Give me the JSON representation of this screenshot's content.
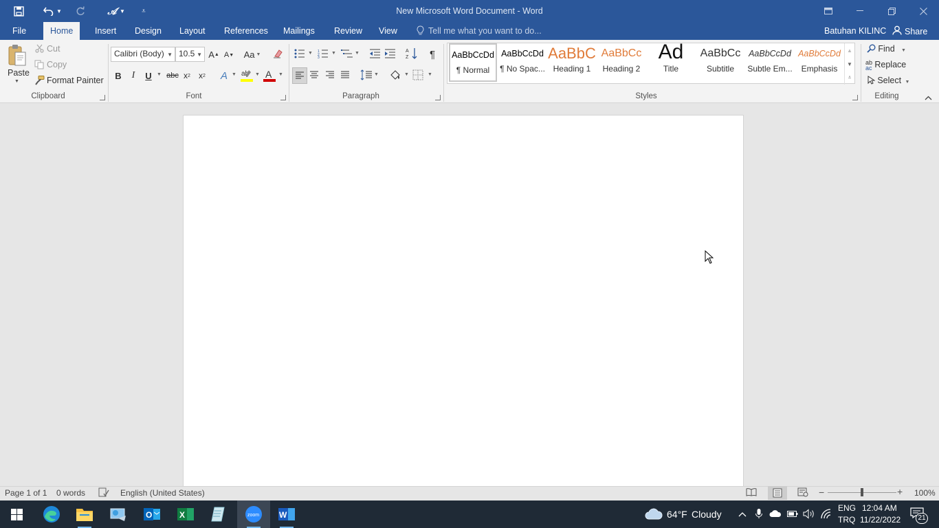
{
  "window": {
    "title": "New Microsoft Word Document - Word",
    "user": "Batuhan KILINC",
    "share_label": "Share"
  },
  "tabs": [
    {
      "label": "File"
    },
    {
      "label": "Home"
    },
    {
      "label": "Insert"
    },
    {
      "label": "Design"
    },
    {
      "label": "Layout"
    },
    {
      "label": "References"
    },
    {
      "label": "Mailings"
    },
    {
      "label": "Review"
    },
    {
      "label": "View"
    }
  ],
  "tell_me": {
    "placeholder": "Tell me what you want to do..."
  },
  "clipboard": {
    "group_label": "Clipboard",
    "paste": "Paste",
    "cut": "Cut",
    "copy": "Copy",
    "format_painter": "Format Painter"
  },
  "font": {
    "group_label": "Font",
    "name": "Calibri (Body)",
    "size": "10.5",
    "change_case": "Aa"
  },
  "paragraph": {
    "group_label": "Paragraph"
  },
  "styles": {
    "group_label": "Styles",
    "items": [
      {
        "preview": "AaBbCcDd",
        "name": "¶ Normal",
        "color": "#000000"
      },
      {
        "preview": "AaBbCcDd",
        "name": "¶ No Spac...",
        "color": "#000000"
      },
      {
        "preview": "AaBbC",
        "name": "Heading 1",
        "color": "#e07b39"
      },
      {
        "preview": "AaBbCc",
        "name": "Heading 2",
        "color": "#e07b39"
      },
      {
        "preview": "Ad",
        "name": "Title",
        "color": "#111111"
      },
      {
        "preview": "AaBbCc",
        "name": "Subtitle",
        "color": "#333333"
      },
      {
        "preview": "AaBbCcDd",
        "name": "Subtle Em...",
        "color": "#333333"
      },
      {
        "preview": "AaBbCcDd",
        "name": "Emphasis",
        "color": "#e07b39"
      }
    ]
  },
  "editing": {
    "group_label": "Editing",
    "find": "Find",
    "replace": "Replace",
    "select": "Select"
  },
  "status": {
    "page": "Page 1 of 1",
    "words": "0 words",
    "language": "English (United States)",
    "zoom": "100%",
    "zoom_level": 1.0
  },
  "taskbar": {
    "weather_temp": "64°F",
    "weather_text": "Cloudy",
    "lang_top": "ENG",
    "lang_bottom": "TRQ",
    "time": "12:04 AM",
    "date": "11/22/2022",
    "notif_count": "21",
    "apps": [
      "start",
      "edge",
      "file-explorer",
      "control-panel",
      "outlook",
      "excel",
      "notepad",
      "zoom",
      "word"
    ]
  },
  "colors": {
    "brand": "#2b579a",
    "ribbon": "#f3f3f3",
    "canvas": "#e6e6e6",
    "accent": "#e07b39"
  }
}
